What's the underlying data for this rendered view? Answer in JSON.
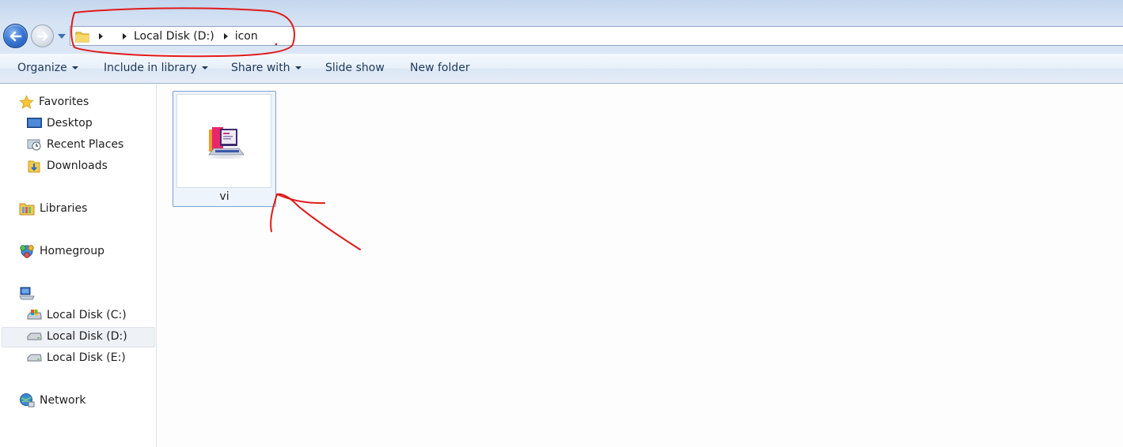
{
  "navigation": {
    "back_label": "Back",
    "forward_label": "Forward",
    "breadcrumb": [
      "Local Disk (D:)",
      "icon"
    ]
  },
  "toolbar": {
    "organize": "Organize",
    "include_in_library": "Include in library",
    "share_with": "Share with",
    "slide_show": "Slide show",
    "new_folder": "New folder"
  },
  "sidebar": {
    "favorites": {
      "label": "Favorites",
      "icon": "star-icon"
    },
    "favorites_items": [
      {
        "label": "Desktop",
        "icon": "desktop-icon"
      },
      {
        "label": "Recent Places",
        "icon": "recent-places-icon"
      },
      {
        "label": "Downloads",
        "icon": "downloads-folder-icon"
      }
    ],
    "libraries": {
      "label": "Libraries",
      "icon": "libraries-icon"
    },
    "homegroup": {
      "label": "Homegroup",
      "icon": "homegroup-icon"
    },
    "computer": {
      "label": "",
      "icon": "computer-icon"
    },
    "drives": [
      {
        "label": "Local Disk (C:)",
        "icon": "system-drive-icon"
      },
      {
        "label": "Local Disk (D:)",
        "icon": "drive-icon",
        "selected": true
      },
      {
        "label": "Local Disk (E:)",
        "icon": "drive-icon"
      }
    ],
    "network": {
      "label": "Network",
      "icon": "network-icon"
    }
  },
  "files": [
    {
      "name": "vi",
      "icon": "laptop-books-image-icon"
    }
  ],
  "colors": {
    "annotation": "#e01a1a",
    "selection_border": "#7da2ce",
    "command_text": "#1e395b"
  }
}
